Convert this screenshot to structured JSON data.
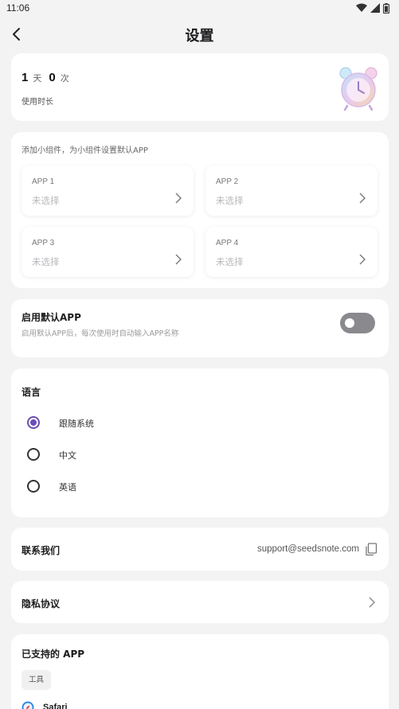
{
  "status_bar": {
    "time": "11:06"
  },
  "header": {
    "title": "设置"
  },
  "usage": {
    "days": "1",
    "days_unit": "天",
    "times": "0",
    "times_unit": "次",
    "label": "使用时长"
  },
  "widgets": {
    "title": "添加小组件，为小组件设置默认APP",
    "apps": [
      {
        "name": "APP 1",
        "value": "未选择"
      },
      {
        "name": "APP 2",
        "value": "未选择"
      },
      {
        "name": "APP 3",
        "value": "未选择"
      },
      {
        "name": "APP 4",
        "value": "未选择"
      }
    ]
  },
  "default_app": {
    "title": "启用默认APP",
    "subtitle": "启用默认APP后，每次使用时自动输入APP名称",
    "enabled": false
  },
  "language": {
    "title": "语言",
    "options": [
      {
        "label": "跟随系统",
        "selected": true
      },
      {
        "label": "中文",
        "selected": false
      },
      {
        "label": "英语",
        "selected": false
      }
    ]
  },
  "contact": {
    "title": "联系我们",
    "email": "support@seedsnote.com"
  },
  "privacy": {
    "title": "隐私协议"
  },
  "supported": {
    "title": "已支持的 APP",
    "category": "工具",
    "apps": [
      {
        "name": "Safari"
      }
    ]
  },
  "colors": {
    "accent": "#6b4fb6",
    "toggle_off": "#8a8a8e",
    "background": "#f3f3f4"
  }
}
